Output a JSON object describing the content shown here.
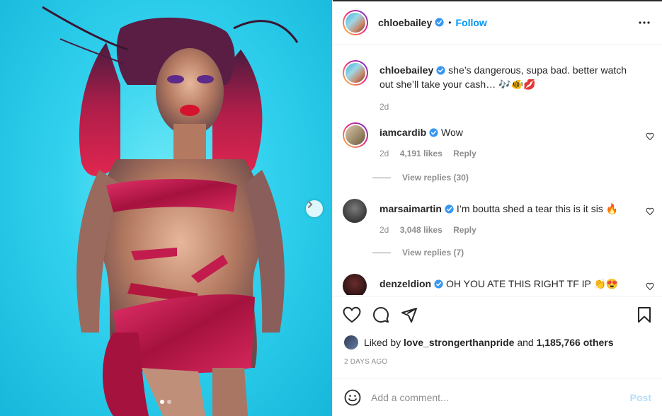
{
  "post": {
    "author": "chloebailey",
    "follow_label": "Follow",
    "separator": "•",
    "caption": {
      "username": "chloebailey",
      "text": "she’s dangerous, supa bad. better watch out she’ll take your cash… 🎶🐠💋",
      "time": "2d"
    }
  },
  "comments": [
    {
      "username": "iamcardib",
      "text": "Wow",
      "time": "2d",
      "likes": "4,191 likes",
      "reply_label": "Reply",
      "view_replies": "View replies (30)"
    },
    {
      "username": "marsaimartin",
      "text": "I’m boutta shed a tear this is it sis 🔥",
      "time": "2d",
      "likes": "3,048 likes",
      "reply_label": "Reply",
      "view_replies": "View replies (7)"
    },
    {
      "username": "denzeldion",
      "text": "OH YOU ATE THIS RIGHT TF IP 👏😍"
    }
  ],
  "liked_by": {
    "prefix": "Liked by",
    "user": "love_strongerthanpride",
    "and": "and",
    "others": "1,185,766 others"
  },
  "timestamp": "2 DAYS AGO",
  "add_comment": {
    "placeholder": "Add a comment...",
    "post_label": "Post"
  },
  "carousel": {
    "total": 2,
    "current": 1
  },
  "colors": {
    "accent": "#0095f6",
    "post_disabled": "#b2dffc",
    "muted": "#8e8e8e"
  },
  "icons": [
    "verified-badge-icon",
    "more-options-icon",
    "heart-icon",
    "comment-icon",
    "share-icon",
    "bookmark-icon",
    "emoji-icon",
    "chevron-right-icon"
  ]
}
